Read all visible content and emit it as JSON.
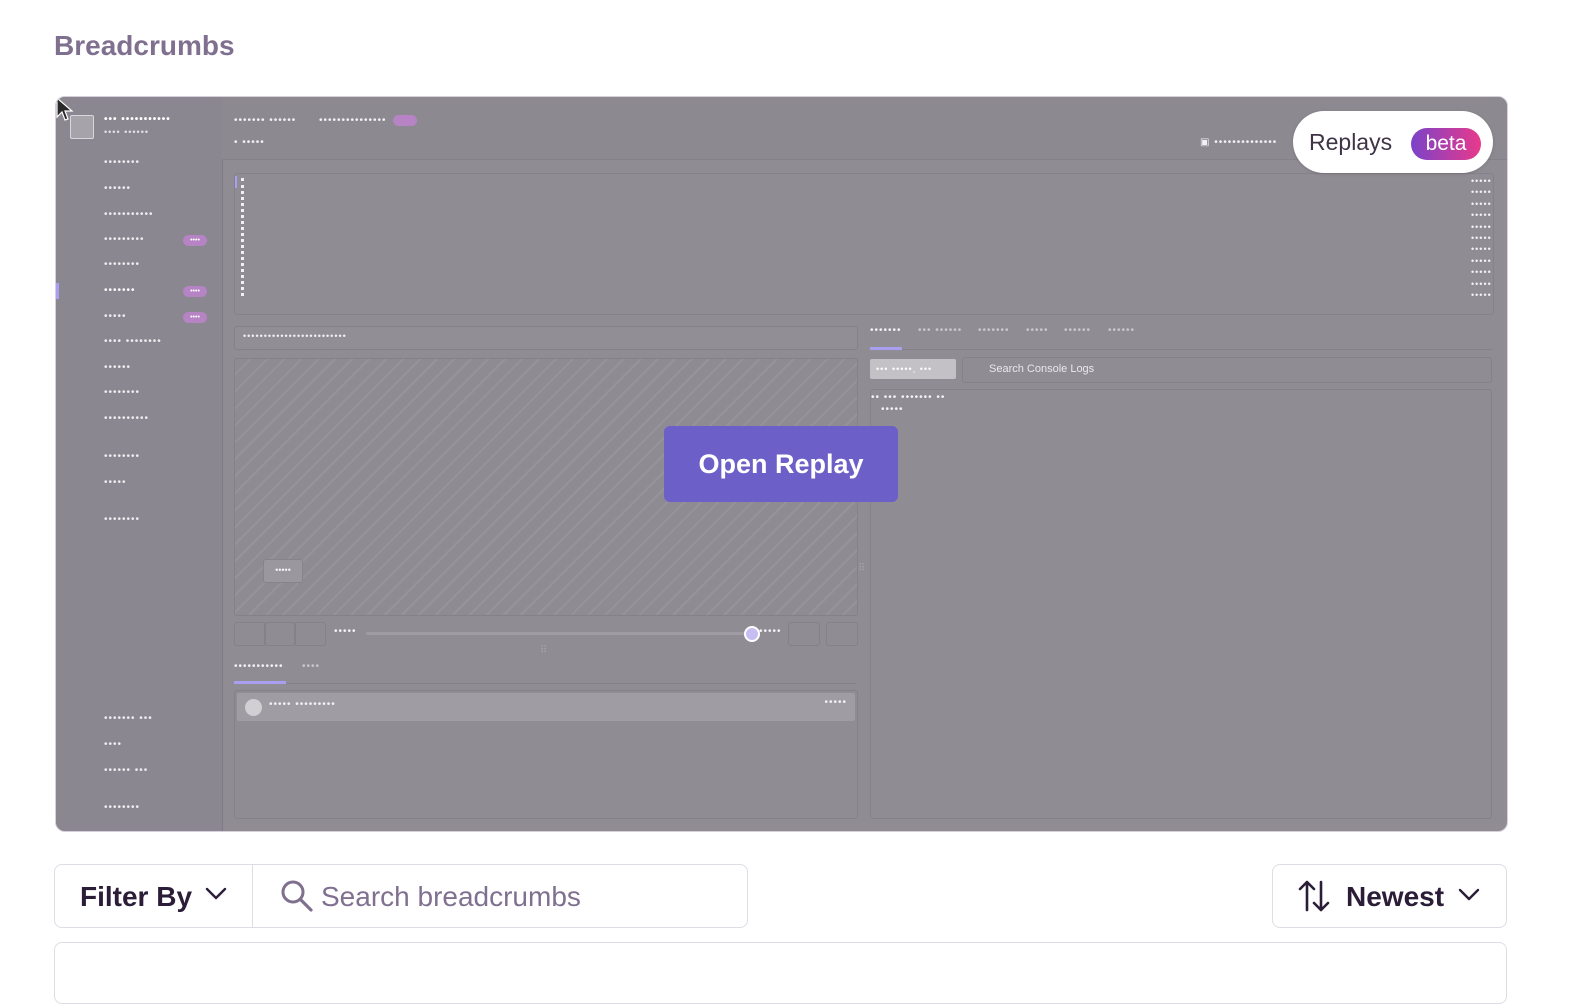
{
  "section": {
    "title": "Breadcrumbs"
  },
  "preview": {
    "replays_label": "Replays",
    "beta_label": "beta",
    "open_replay_label": "Open Replay",
    "console_search_placeholder": "Search Console Logs"
  },
  "toolbar": {
    "filter_label": "Filter By",
    "search_placeholder": "Search breadcrumbs",
    "search_value": "",
    "sort_label": "Newest"
  },
  "colors": {
    "heading": "#80708f",
    "accent": "#6c5fc7",
    "beta_gradient_start": "#7b43c9",
    "beta_gradient_end": "#e8398b",
    "overlay": "#908c93"
  }
}
